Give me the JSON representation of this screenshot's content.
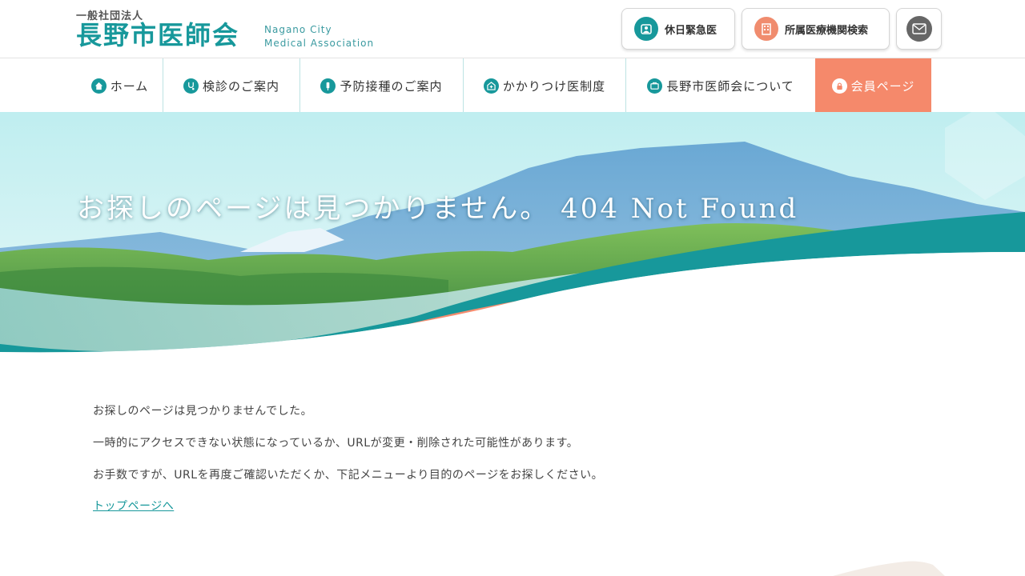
{
  "header": {
    "logo_sub": "一般社団法人",
    "logo_main": "長野市医師会",
    "logo_en_line1": "Nagano City",
    "logo_en_line2": "Medical Association",
    "btn_holiday": "休日緊急医",
    "btn_search": "所属医療機関検索",
    "btn_mail_icon": "mail-icon"
  },
  "nav": {
    "items": [
      {
        "label": "ホーム",
        "icon": "home-icon"
      },
      {
        "label": "検診のご案内",
        "icon": "stethoscope-icon"
      },
      {
        "label": "予防接種のご案内",
        "icon": "vaccine-icon"
      },
      {
        "label": "かかりつけ医制度",
        "icon": "clinic-icon"
      },
      {
        "label": "長野市医師会について",
        "icon": "info-icon"
      },
      {
        "label": "会員ページ",
        "icon": "lock-icon"
      }
    ]
  },
  "hero": {
    "title": "お探しのページは見つかりません。 404 Not Found"
  },
  "content": {
    "line1": "お探しのページは見つかりませんでした。",
    "line2": "一時的にアクセスできない状態になっているか、URLが変更・削除された可能性があります。",
    "line3": "お手数ですが、URLを再度ご確認いただくか、下記メニューより目的のページをお探しください。",
    "link_top": "トップページへ"
  },
  "colors": {
    "teal": "#17989b",
    "coral": "#f5896b",
    "text": "#444444"
  }
}
